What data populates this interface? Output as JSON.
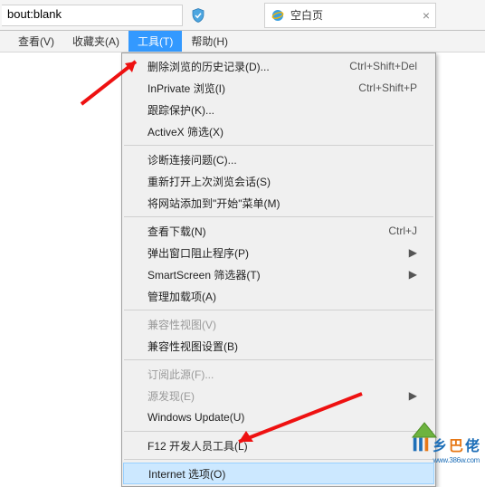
{
  "address_bar": {
    "url": "bout:blank",
    "tab_title": "空白页",
    "tab_close": "×"
  },
  "menubar": {
    "view": "查看(V)",
    "favorites": "收藏夹(A)",
    "tools": "工具(T)",
    "help": "帮助(H)"
  },
  "tools_menu": {
    "delete_history": "删除浏览的历史记录(D)...",
    "delete_history_short": "Ctrl+Shift+Del",
    "inprivate": "InPrivate 浏览(I)",
    "inprivate_short": "Ctrl+Shift+P",
    "tracking_protection": "跟踪保护(K)...",
    "activex": "ActiveX 筛选(X)",
    "diagnose": "诊断连接问题(C)...",
    "reopen": "重新打开上次浏览会话(S)",
    "add_to_start": "将网站添加到\"开始\"菜单(M)",
    "view_downloads": "查看下载(N)",
    "view_downloads_short": "Ctrl+J",
    "popup_blocker": "弹出窗口阻止程序(P)",
    "smartscreen": "SmartScreen 筛选器(T)",
    "manage_addons": "管理加载项(A)",
    "compat_view": "兼容性视图(V)",
    "compat_settings": "兼容性视图设置(B)",
    "feed_subscribe": "订阅此源(F)...",
    "feed_discovery": "源发现(E)",
    "windows_update": "Windows Update(U)",
    "f12": "F12 开发人员工具(L)",
    "internet_options": "Internet 选项(O)"
  },
  "submenu_arrow": "▶",
  "watermark": {
    "t1": "乡",
    "t2": "巴",
    "t3": "佬",
    "url": "www.386w.com"
  }
}
